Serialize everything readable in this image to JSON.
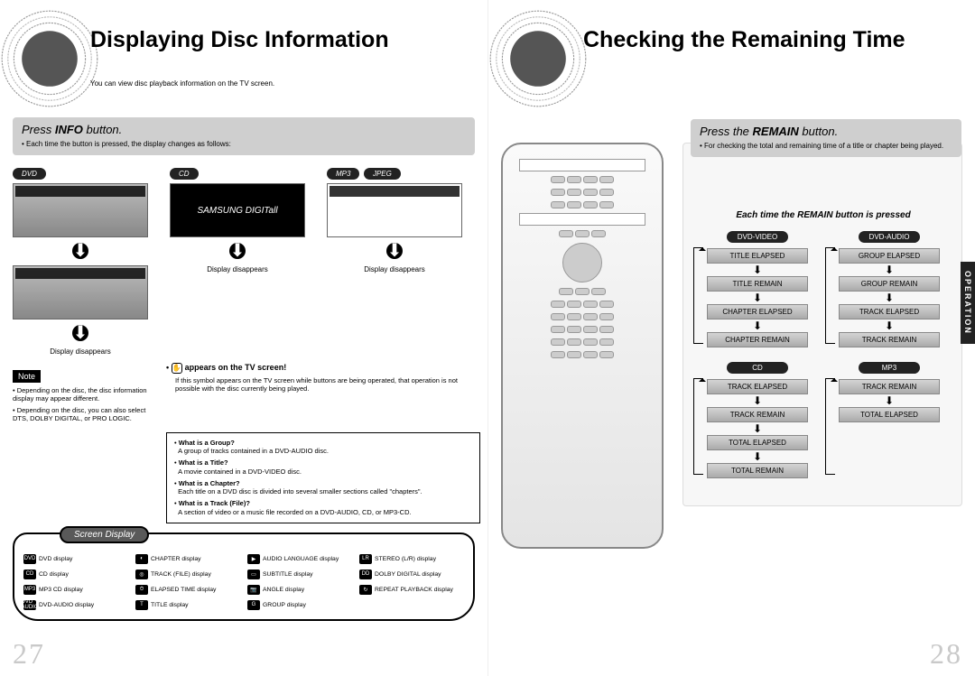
{
  "left": {
    "title": "Displaying Disc Information",
    "sub": "You can view disc playback information on the TV screen.",
    "band_title_pre": "Press ",
    "band_title_bold": "INFO",
    "band_title_post": " button.",
    "band_sub": "• Each time the button is pressed, the display changes as follows:",
    "chips": {
      "dvd": "DVD",
      "cd": "CD",
      "mp3": "MP3",
      "jpeg": "JPEG"
    },
    "digitall": "SAMSUNG DIGITall",
    "display_disappears": "Display disappears",
    "appears_heading": "appears on the TV screen!",
    "appears_text": "If this symbol appears on the TV screen while buttons are being operated, that operation is not possible with the disc currently being played.",
    "note_tag": "Note",
    "notes": [
      "Depending on the disc, the disc information display may appear different.",
      "Depending on the disc, you can also select DTS, DOLBY DIGITAL, or PRO LOGIC."
    ],
    "defs": [
      {
        "q": "What is a Group?",
        "a": "A group of tracks contained in a DVD-AUDIO disc."
      },
      {
        "q": "What is a Title?",
        "a": "A movie contained in a DVD-VIDEO disc."
      },
      {
        "q": "What is a Chapter?",
        "a": "Each title on a DVD disc is divided into several smaller sections called \"chapters\"."
      },
      {
        "q": "What is a Track (File)?",
        "a": "A section of video or a music file recorded on a DVD-AUDIO, CD, or MP3-CD."
      }
    ],
    "sd_pill": "Screen Display",
    "sd": [
      {
        "i": "DVD",
        "t": "DVD display"
      },
      {
        "i": "◐",
        "t": "CHAPTER display"
      },
      {
        "i": "▶",
        "t": "AUDIO LANGUAGE display"
      },
      {
        "i": "LR",
        "t": "STEREO (L/R) display"
      },
      {
        "i": "CD",
        "t": "CD display"
      },
      {
        "i": "◎",
        "t": "TRACK (FILE) display"
      },
      {
        "i": "▭",
        "t": "SUBTITLE display"
      },
      {
        "i": "DD",
        "t": "DOLBY DIGITAL display"
      },
      {
        "i": "MP3",
        "t": "MP3 CD display"
      },
      {
        "i": "⏱",
        "t": "ELAPSED TIME display"
      },
      {
        "i": "📷",
        "t": "ANGLE display"
      },
      {
        "i": "↻",
        "t": "REPEAT PLAYBACK display"
      },
      {
        "i": "DVD\nAUDIO",
        "t": "DVD-AUDIO display"
      },
      {
        "i": "T",
        "t": "TITLE display"
      },
      {
        "i": "G",
        "t": "GROUP display"
      }
    ],
    "page_num": "27"
  },
  "right": {
    "title": "Checking the Remaining Time",
    "band_title_pre": "Press the ",
    "band_title_bold": "REMAIN",
    "band_title_post": " button.",
    "band_sub": "• For checking the total and remaining time of a title or chapter being played.",
    "each_heading": "Each time the REMAIN button is pressed",
    "op_tab": "OPERATION",
    "flows": [
      {
        "head": "DVD-VIDEO",
        "steps": [
          "TITLE ELAPSED",
          "TITLE REMAIN",
          "CHAPTER ELAPSED",
          "CHAPTER REMAIN"
        ]
      },
      {
        "head": "DVD-AUDIO",
        "steps": [
          "GROUP ELAPSED",
          "GROUP REMAIN",
          "TRACK ELAPSED",
          "TRACK REMAIN"
        ]
      },
      {
        "head": "CD",
        "steps": [
          "TRACK ELAPSED",
          "TRACK REMAIN",
          "TOTAL ELAPSED",
          "TOTAL REMAIN"
        ]
      },
      {
        "head": "MP3",
        "steps": [
          "TRACK REMAIN",
          "TOTAL ELAPSED"
        ]
      }
    ],
    "page_num": "28"
  }
}
